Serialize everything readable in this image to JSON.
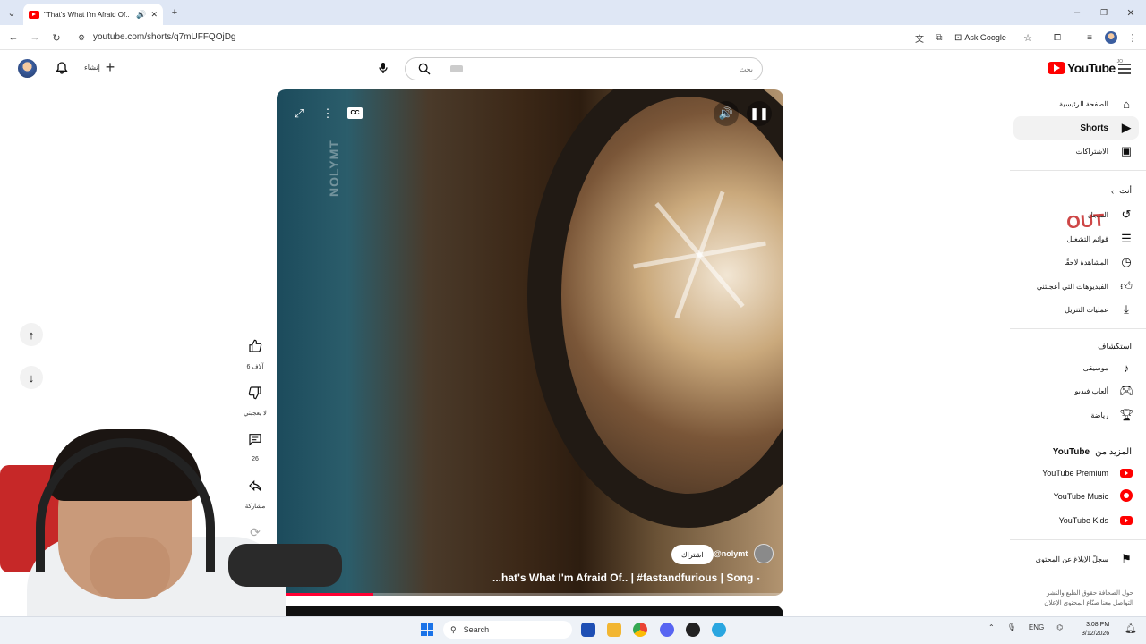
{
  "browser": {
    "tab_title": "\"That's What I'm Afraid Of..",
    "url": "youtube.com/shorts/q7mUFFQOjDg",
    "ask_google": "Ask Google"
  },
  "header": {
    "create_label": "إنشاء",
    "search_placeholder": "بحث",
    "logo_text": "YouTube",
    "logo_region": "JO"
  },
  "sidebar": {
    "main": [
      {
        "label": "الصفحة الرئيسية",
        "icon": "home-icon"
      },
      {
        "label": "Shorts",
        "icon": "shorts-icon"
      },
      {
        "label": "الاشتراكات",
        "icon": "subscriptions-icon"
      }
    ],
    "you_heading": "أنت",
    "you_items": [
      {
        "label": "السجل",
        "icon": "history-icon"
      },
      {
        "label": "قوائم التشغيل",
        "icon": "playlists-icon"
      },
      {
        "label": "المشاهدة لاحقًا",
        "icon": "watch-later-icon"
      },
      {
        "label": "الفيديوهات التي أعجبتني",
        "icon": "like-icon"
      },
      {
        "label": "عمليات التنزيل",
        "icon": "download-icon"
      }
    ],
    "explore_heading": "استكشاف",
    "explore_items": [
      {
        "label": "موسيقى",
        "icon": "music-icon"
      },
      {
        "label": "ألعاب فيديو",
        "icon": "gaming-icon"
      },
      {
        "label": "رياضة",
        "icon": "trophy-icon"
      }
    ],
    "more_heading": "المزيد من",
    "more_heading_brand": "YouTube",
    "more_items": [
      {
        "label": "YouTube Premium",
        "icon": "yt-premium-icon"
      },
      {
        "label": "YouTube Music",
        "icon": "yt-music-icon"
      },
      {
        "label": "YouTube Kids",
        "icon": "yt-kids-icon"
      }
    ],
    "report_history": "سجلّ الإبلاغ عن المحتوى",
    "footer_line1": "حول  الصحافة  حقوق الطبع والنشر",
    "footer_line2": "التواصل معنا  صنّاع المحتوى  الإعلان"
  },
  "video": {
    "watermark_text": "NOLYMT",
    "channel": "@nolymt",
    "subscribe_label": "اشتراك",
    "title": "...hat's What I'm Afraid Of.. | #fastandfurious | Song -",
    "cc_label": "CC",
    "progress_fraction": 0.19
  },
  "actions": {
    "likes": "6 آلاف",
    "dislike_label": "لا يعجبني",
    "comments": "26",
    "share_label": "مشاركة"
  },
  "overlay_logo_text": "OUT",
  "taskbar": {
    "search_label": "Search",
    "lang": "ENG",
    "time": "3:08 PM",
    "date": "3/12/2026"
  },
  "colors": {
    "brand_red": "#ff0000",
    "progress_red": "#ff0033",
    "sidebar_active_bg": "#f2f2f2"
  }
}
